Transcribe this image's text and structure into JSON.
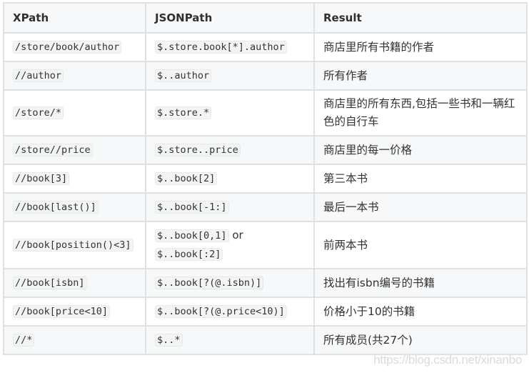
{
  "table": {
    "headers": [
      "XPath",
      "JSONPath",
      "Result"
    ],
    "rows": [
      {
        "xpath": "/store/book/author",
        "jsonpath": "$.store.book[*].author",
        "result": "商店里所有书籍的作者"
      },
      {
        "xpath": "//author",
        "jsonpath": "$..author",
        "result": "所有作者"
      },
      {
        "xpath": "/store/*",
        "jsonpath": "$.store.*",
        "result": "商店里的所有东西,包括一些书和一辆红色的自行车"
      },
      {
        "xpath": "/store//price",
        "jsonpath": "$.store..price",
        "result": "商店里的每一价格"
      },
      {
        "xpath": "//book[3]",
        "jsonpath": "$..book[2]",
        "result": "第三本书"
      },
      {
        "xpath": "//book[last()]",
        "jsonpath": "$..book[-1:]",
        "result": "最后一本书"
      },
      {
        "xpath": "//book[position()<3]",
        "jsonpath": "$..book[0,1]",
        "jsonpath_or": "or",
        "jsonpath_alt": "$..book[:2]",
        "result": "前两本书"
      },
      {
        "xpath": "//book[isbn]",
        "jsonpath": "$..book[?(@.isbn)]",
        "result": "找出有isbn编号的书籍"
      },
      {
        "xpath": "//book[price<10]",
        "jsonpath": "$..book[?(@.price<10)]",
        "result": "价格小于10的书籍"
      },
      {
        "xpath": "//*",
        "jsonpath": "$..*",
        "result": "所有成员(共27个)"
      }
    ]
  },
  "watermark": "https://blog.csdn.net/xinanbo"
}
